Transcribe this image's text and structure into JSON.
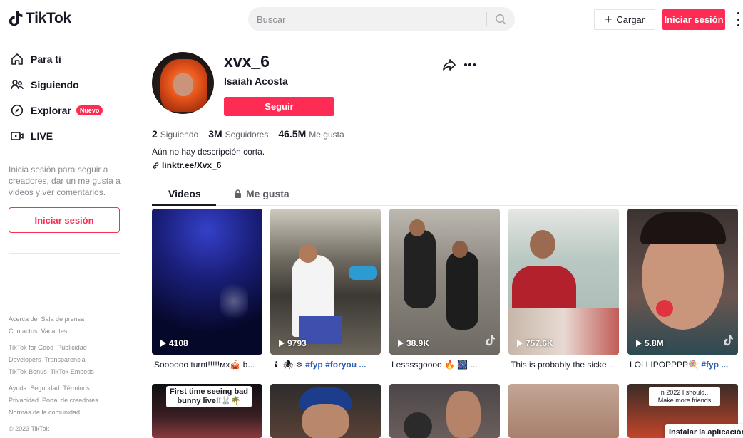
{
  "header": {
    "logo_text": "TikTok",
    "search_placeholder": "Buscar",
    "upload_label": "Cargar",
    "login_label": "Iniciar sesión"
  },
  "sidebar": {
    "nav": [
      {
        "label": "Para ti",
        "icon": "home-icon"
      },
      {
        "label": "Siguiendo",
        "icon": "users-icon"
      },
      {
        "label": "Explorar",
        "icon": "compass-icon",
        "badge": "Nuevo"
      },
      {
        "label": "LIVE",
        "icon": "live-icon"
      }
    ],
    "login_hint": "Inicia sesión para seguir a creadores, dar un me gusta a videos y ver comentarios.",
    "login_button": "Iniciar sesión",
    "footer": [
      [
        "Acerca de",
        "Sala de prensa"
      ],
      [
        "Contactos",
        "Vacantes"
      ],
      [
        "TikTok for Good",
        "Publicidad"
      ],
      [
        "Developers",
        "Transparencia"
      ],
      [
        "TikTok Bonus",
        "TikTok Embeds"
      ],
      [
        "Ayuda",
        "Seguridad",
        "Términos"
      ],
      [
        "Privacidad",
        "Portal de creadores"
      ],
      [
        "Normas de la comunidad"
      ]
    ],
    "copyright": "© 2023 TikTok"
  },
  "profile": {
    "username": "xvx_6",
    "nickname": "Isaiah Acosta",
    "follow_label": "Seguir",
    "stats": {
      "following": {
        "value": "2",
        "label": "Siguiendo"
      },
      "followers": {
        "value": "3M",
        "label": "Seguidores"
      },
      "likes": {
        "value": "46.5M",
        "label": "Me gusta"
      }
    },
    "bio": "Aún no hay descripción corta.",
    "link": "linktr.ee/Xvx_6"
  },
  "tabs": {
    "videos": "Videos",
    "liked": "Me gusta"
  },
  "videos": [
    {
      "views": "4108",
      "caption": "Soooooo turnt!!!!!мх🎪 b...",
      "tag": ""
    },
    {
      "views": "9793",
      "caption": "♝ 🕷 ❄ ",
      "tag": "#fyp #foryou ..."
    },
    {
      "views": "38.9K",
      "caption": "Lessssgoooo 🔥 🎆 ...",
      "tag": ""
    },
    {
      "views": "757.6K",
      "caption": "This is probably the sicke...",
      "tag": ""
    },
    {
      "views": "5.8M",
      "caption": "LOLLIPOPPPP🍭 ",
      "tag": "#fyp ..."
    }
  ],
  "row2": [
    {
      "overlay": "First time seeing bad bunny live!!🐰🌴"
    },
    {
      "overlay": ""
    },
    {
      "overlay": ""
    },
    {
      "overlay": ""
    },
    {
      "overlay": "In 2022 I should... Make more friends"
    }
  ],
  "install_banner": "Instalar la aplicación",
  "colors": {
    "brand": "#fe2c55",
    "text": "#161823",
    "muted": "#8a8b91",
    "tag": "#2b5db9"
  }
}
